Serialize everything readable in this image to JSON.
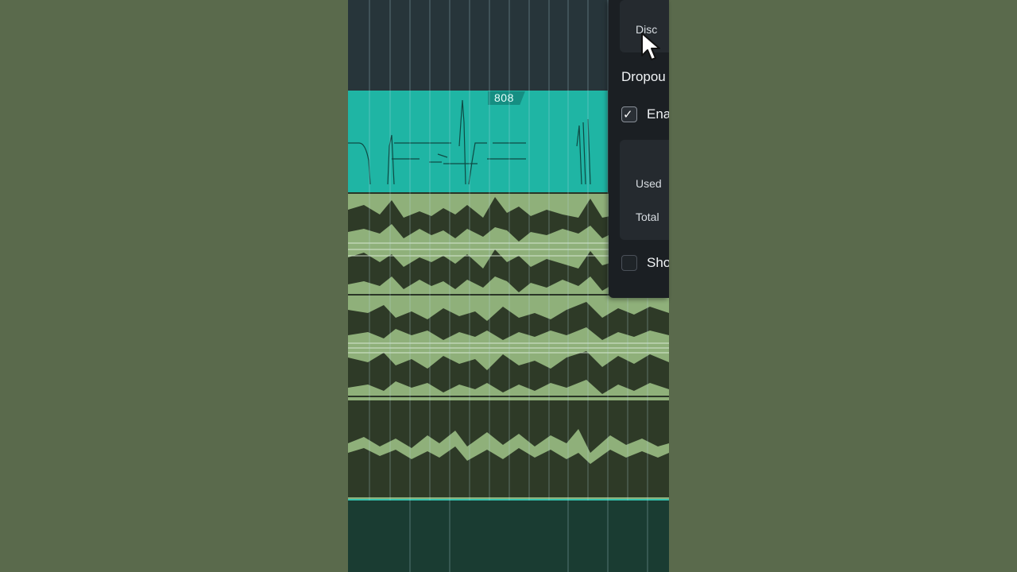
{
  "tracks": {
    "clip_808_label": "808"
  },
  "panel": {
    "disc_label": "Disc",
    "section_title": "Dropou",
    "enable_label": "Ena",
    "enable_checked": true,
    "used_label": "Used",
    "total_label": "Total",
    "show_label": "Sho",
    "show_checked": false
  },
  "colors": {
    "clip_808": "#1fb5a4",
    "audio_light": "#8fb07a",
    "audio_dark": "#2e3a27",
    "panel_bg": "#1b1f23",
    "background": "#5a6a4c"
  },
  "icons": {
    "cursor": "mouse-pointer-icon",
    "check": "checkmark-icon"
  }
}
